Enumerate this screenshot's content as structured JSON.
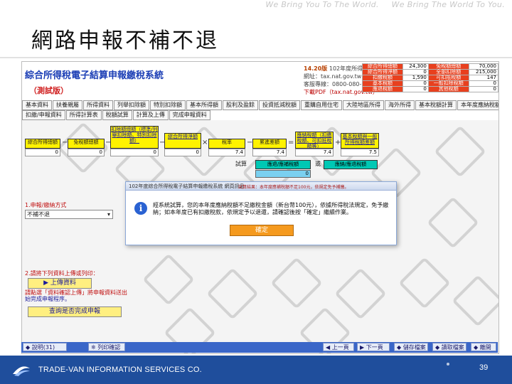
{
  "slide": {
    "slogan_left": "We Bring You To The World.",
    "slogan_right": "We Bring The World To You.",
    "title": "網路申報不補不退",
    "page_number": "39"
  },
  "footer": {
    "company": "TRADE-VAN INFORMATION SERVICES CO."
  },
  "app": {
    "title": "綜合所得稅電子結算申報繳稅系統",
    "subtitle": "（測試版）",
    "version_label": "14.20版",
    "version_detail": "102年度所得",
    "version_line2": "網址：tax.nat.gov.tw",
    "version_line3": "客服專線：0800-080-087",
    "download_link": "下載PDF（tax.nat.gov.tw）",
    "summary_rows": [
      {
        "label": "綜合所得總額",
        "value": "24,300",
        "label2": "免稅額總額",
        "value2": "70,000"
      },
      {
        "label": "綜合所得淨額",
        "value": "0",
        "label2": "全部扣除額",
        "value2": "215,000"
      },
      {
        "label": "扣繳稅額",
        "value": "1,590",
        "label2": "可扣抵稅額",
        "value2": "147"
      },
      {
        "label": "基本稅額",
        "value": "0",
        "label2": "一般扣除稅額",
        "value2": "0"
      },
      {
        "label": "應退稅額",
        "value": "0",
        "label2": "其他稅額",
        "value2": "0"
      }
    ],
    "nav_row1": [
      "基本資料",
      "扶養親屬",
      "所得資料",
      "列舉扣除額",
      "特別扣除額",
      "基本所得額",
      "股利及盈餘",
      "投資抵減稅額",
      "重購自用住宅",
      "大陸地區所得",
      "海外所得",
      "基本稅額計算",
      "本年度應納稅額",
      "退稅及申報方式"
    ],
    "nav_row2": [
      "扣繳/申報資料",
      "所得計算表",
      "稅額試算",
      "計算及上傳",
      "完成申報資料"
    ],
    "flow": {
      "box1": {
        "label": "綜合所得總額",
        "value": "0"
      },
      "box2": {
        "label": "免稅額總額",
        "value": "0"
      },
      "box3": {
        "label": "扣除額總額（標準/列舉扣除額、特別扣除額）",
        "value": "0"
      },
      "box4": {
        "label": "綜合所得淨額",
        "value": "0"
      },
      "box5": {
        "label": "稅率",
        "value": "7.4"
      },
      "box6": {
        "label": "累進差額",
        "value": "7.4"
      },
      "box7": {
        "label": "應納稅額（扣繳稅額、可扣抵稅額等）",
        "value": "7.4"
      },
      "box8": {
        "label": "基本稅額與一般所得稅額差額",
        "value": "7.5"
      },
      "ops": [
        "−",
        "−",
        "−",
        "×",
        "−",
        "=",
        "+"
      ],
      "calc_label1": "試算",
      "calc_btn1": "應退/應補稅額",
      "calc_op": "或",
      "calc_btn2": "應納/應退稅額",
      "calc_value": "0"
    },
    "section1_head": "1.申報/繳納方式",
    "section1_select": "不補不退",
    "section2_head": "2.請將下列資料上傳或列印：",
    "upload_button": "上傳資料",
    "warning_line1": "請點選「資料確認上傳」將申報資料送出",
    "warning_line2": "始完成申報程序。",
    "check_button": "查詢是否完成申報"
  },
  "dialog": {
    "title": "102年度綜合所得稅電子結算申報繳稅系統 網頁訊息",
    "inner_note": "試算結果：本年度應補稅額不足100元，依規定免予補繳。",
    "message": "經系統試算，您的本年度應納稅額不足繳稅金額（新台幣100元），依據所得稅法規定，免予繳納；如本年度已有扣繳稅款，依規定予以退還，請確認後按「確定」繼續作業。",
    "ok_label": "確定"
  },
  "toolbar": {
    "left": [
      "◆ 說明(31)",
      "※ 列印確認"
    ],
    "right": [
      "◀ 上一頁",
      "▶ 下一頁",
      "◆ 儲存檔案",
      "◆ 讀取檔案",
      "◆ 離開"
    ]
  },
  "colors": {
    "accent_yellow": "#fff200",
    "accent_teal": "#00c8b4",
    "footer_blue": "#1f4e9c",
    "title_red": "#d02020",
    "link_blue": "#1a3db5"
  }
}
